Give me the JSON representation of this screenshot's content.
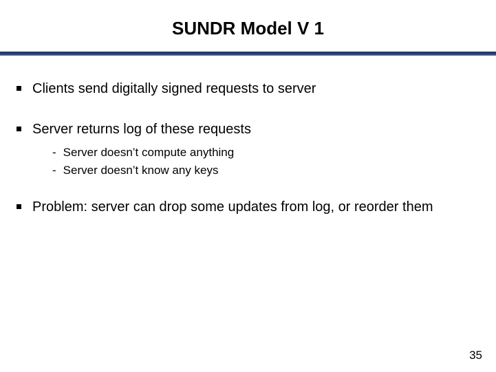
{
  "title": "SUNDR Model V 1",
  "bullets": [
    {
      "text": "Clients send digitally signed requests to server",
      "subs": []
    },
    {
      "text": "Server returns log of these requests",
      "subs": [
        "Server doesn’t compute anything",
        "Server doesn’t know any keys"
      ]
    },
    {
      "text": "Problem: server can drop some updates from log, or reorder them",
      "subs": []
    }
  ],
  "page_number": "35"
}
